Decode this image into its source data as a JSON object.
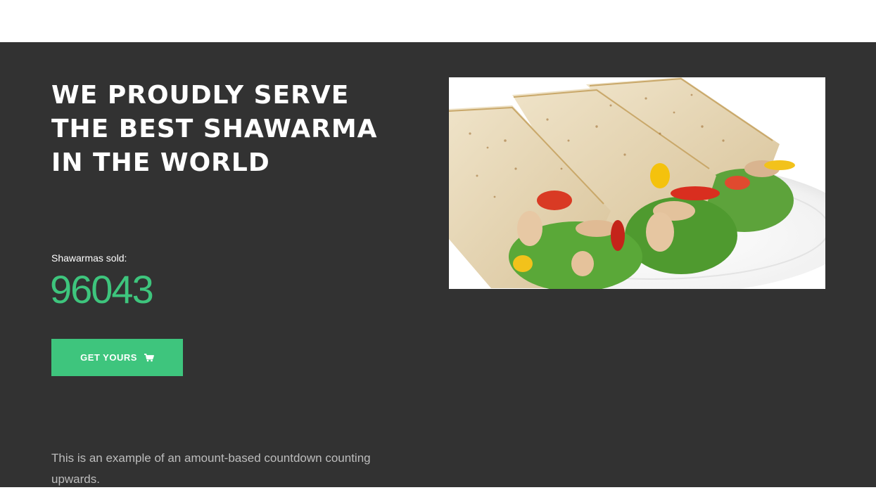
{
  "hero": {
    "heading": "WE PROUDLY SERVE THE BEST SHAWARMA IN THE WORLD",
    "counter_label": "Shawarmas sold:",
    "counter_value": "96043",
    "cta_label": "GET YOURS",
    "cta_icon": "shopping-cart-icon",
    "description": "This is an example of an amount-based countdown counting upwards.",
    "image": "shawarma-wraps-plate"
  },
  "colors": {
    "background": "#323232",
    "accent": "#3ec57d",
    "heading": "#ffffff",
    "description": "#bdbdbd",
    "topbar": "#ffffff"
  }
}
